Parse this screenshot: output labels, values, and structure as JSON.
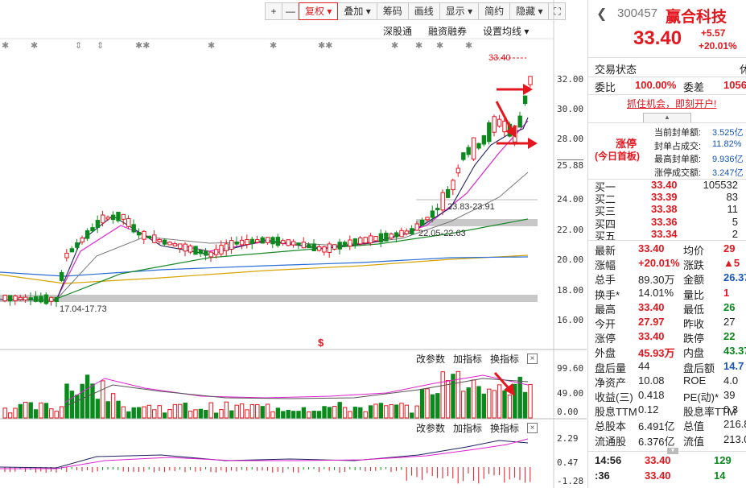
{
  "toolbar": {
    "buttons": [
      "+",
      "—",
      "复权 ▾",
      "叠加 ▾",
      "筹码",
      "画线",
      "显示 ▾",
      "简约",
      "隐藏 ▾",
      "⛶"
    ]
  },
  "subbar": {
    "items": [
      "深股通",
      "融资融券",
      "设置均线 ▾"
    ]
  },
  "chart": {
    "price_axis": [
      "32.00",
      "30.00",
      "28.00",
      "25.88",
      "24.00",
      "22.00",
      "20.00",
      "18.00",
      "16.00"
    ],
    "high_label": "33.40",
    "annotation_low": "17.04-17.73",
    "annotation_mid": "22.05-22.63",
    "annotation_high": "23.83-23.91",
    "marker": "$"
  },
  "volume_panel": {
    "buttons": [
      "改参数",
      "加指标",
      "换指标"
    ],
    "close": "×",
    "axis": [
      "99.60",
      "49.00",
      "0.00"
    ]
  },
  "macd_panel": {
    "buttons": [
      "改参数",
      "加指标",
      "换指标"
    ],
    "close": "×",
    "axis": [
      "2.29",
      "0.47",
      "-1.28"
    ]
  },
  "quote": {
    "code": "300457",
    "name": "赢合科技",
    "price": "33.40",
    "change": "+5.57",
    "change_pct": "+20.01%",
    "status_label": "交易状态",
    "status_value": "休",
    "weibi_label": "委比",
    "weibi_value": "100.00%",
    "weicha_label": "委差",
    "weicha_value": "1056",
    "promo": "抓住机会，即刻开户!",
    "limit_up_title": "涨停",
    "limit_up_sub": "(今日首板)",
    "seal_rows": [
      {
        "label": "当前封单额:",
        "value": "3.525亿"
      },
      {
        "label": "封单占成交:",
        "value": "11.82%"
      },
      {
        "label": "最高封单额:",
        "value": "9.936亿"
      },
      {
        "label": "涨停成交额:",
        "value": "3.247亿"
      }
    ],
    "bids": [
      {
        "label": "买一",
        "price": "33.40",
        "vol": "105532"
      },
      {
        "label": "买二",
        "price": "33.39",
        "vol": "83"
      },
      {
        "label": "买三",
        "price": "33.38",
        "vol": "11"
      },
      {
        "label": "买四",
        "price": "33.36",
        "vol": "5"
      },
      {
        "label": "买五",
        "price": "33.34",
        "vol": "2"
      }
    ],
    "stats": [
      {
        "l1": "最新",
        "v1": "33.40",
        "c1": "red",
        "l2": "均价",
        "v2": "29",
        "c2": "red"
      },
      {
        "l1": "涨幅",
        "v1": "+20.01%",
        "c1": "red",
        "l2": "涨跌",
        "v2": "▲5",
        "c2": "red"
      },
      {
        "l1": "总手",
        "v1": "89.30万",
        "c1": "",
        "l2": "金额",
        "v2": "26.37",
        "c2": "blue"
      },
      {
        "l1": "换手*",
        "v1": "14.01%",
        "c1": "",
        "l2": "量比",
        "v2": "1",
        "c2": "red"
      },
      {
        "l1": "最高",
        "v1": "33.40",
        "c1": "red",
        "l2": "最低",
        "v2": "26",
        "c2": "grn"
      },
      {
        "l1": "今开",
        "v1": "27.97",
        "c1": "red",
        "l2": "昨收",
        "v2": "27",
        "c2": ""
      },
      {
        "l1": "涨停",
        "v1": "33.40",
        "c1": "red",
        "l2": "跌停",
        "v2": "22",
        "c2": "grn"
      },
      {
        "l1": "外盘",
        "v1": "45.93万",
        "c1": "red",
        "l2": "内盘",
        "v2": "43.37",
        "c2": "grn"
      },
      {
        "l1": "盘后量",
        "v1": "44",
        "c1": "",
        "l2": "盘后额",
        "v2": "14.7",
        "c2": "blue"
      },
      {
        "l1": "净资产",
        "v1": "10.08",
        "c1": "",
        "l2": "ROE",
        "v2": "4.0",
        "c2": ""
      },
      {
        "l1": "收益(三)",
        "v1": "0.418",
        "c1": "",
        "l2": "PE(动)*",
        "v2": "39",
        "c2": ""
      },
      {
        "l1": "股息TTM",
        "v1": "0.12",
        "c1": "",
        "l2": "股息率TTM",
        "v2": "0.3",
        "c2": ""
      },
      {
        "l1": "总股本",
        "v1": "6.491亿",
        "c1": "",
        "l2": "总值",
        "v2": "216.8",
        "c2": ""
      },
      {
        "l1": "流通股",
        "v1": "6.376亿",
        "c1": "",
        "l2": "流值",
        "v2": "213.0",
        "c2": ""
      }
    ],
    "ticks": [
      {
        "time": "14:56",
        "price": "33.40",
        "vol": "129"
      },
      {
        "time": ":36",
        "price": "33.40",
        "vol": "14"
      }
    ]
  },
  "colors": {
    "up": "#e4171f",
    "down": "#0a8a1c",
    "accent": "#e02020"
  }
}
